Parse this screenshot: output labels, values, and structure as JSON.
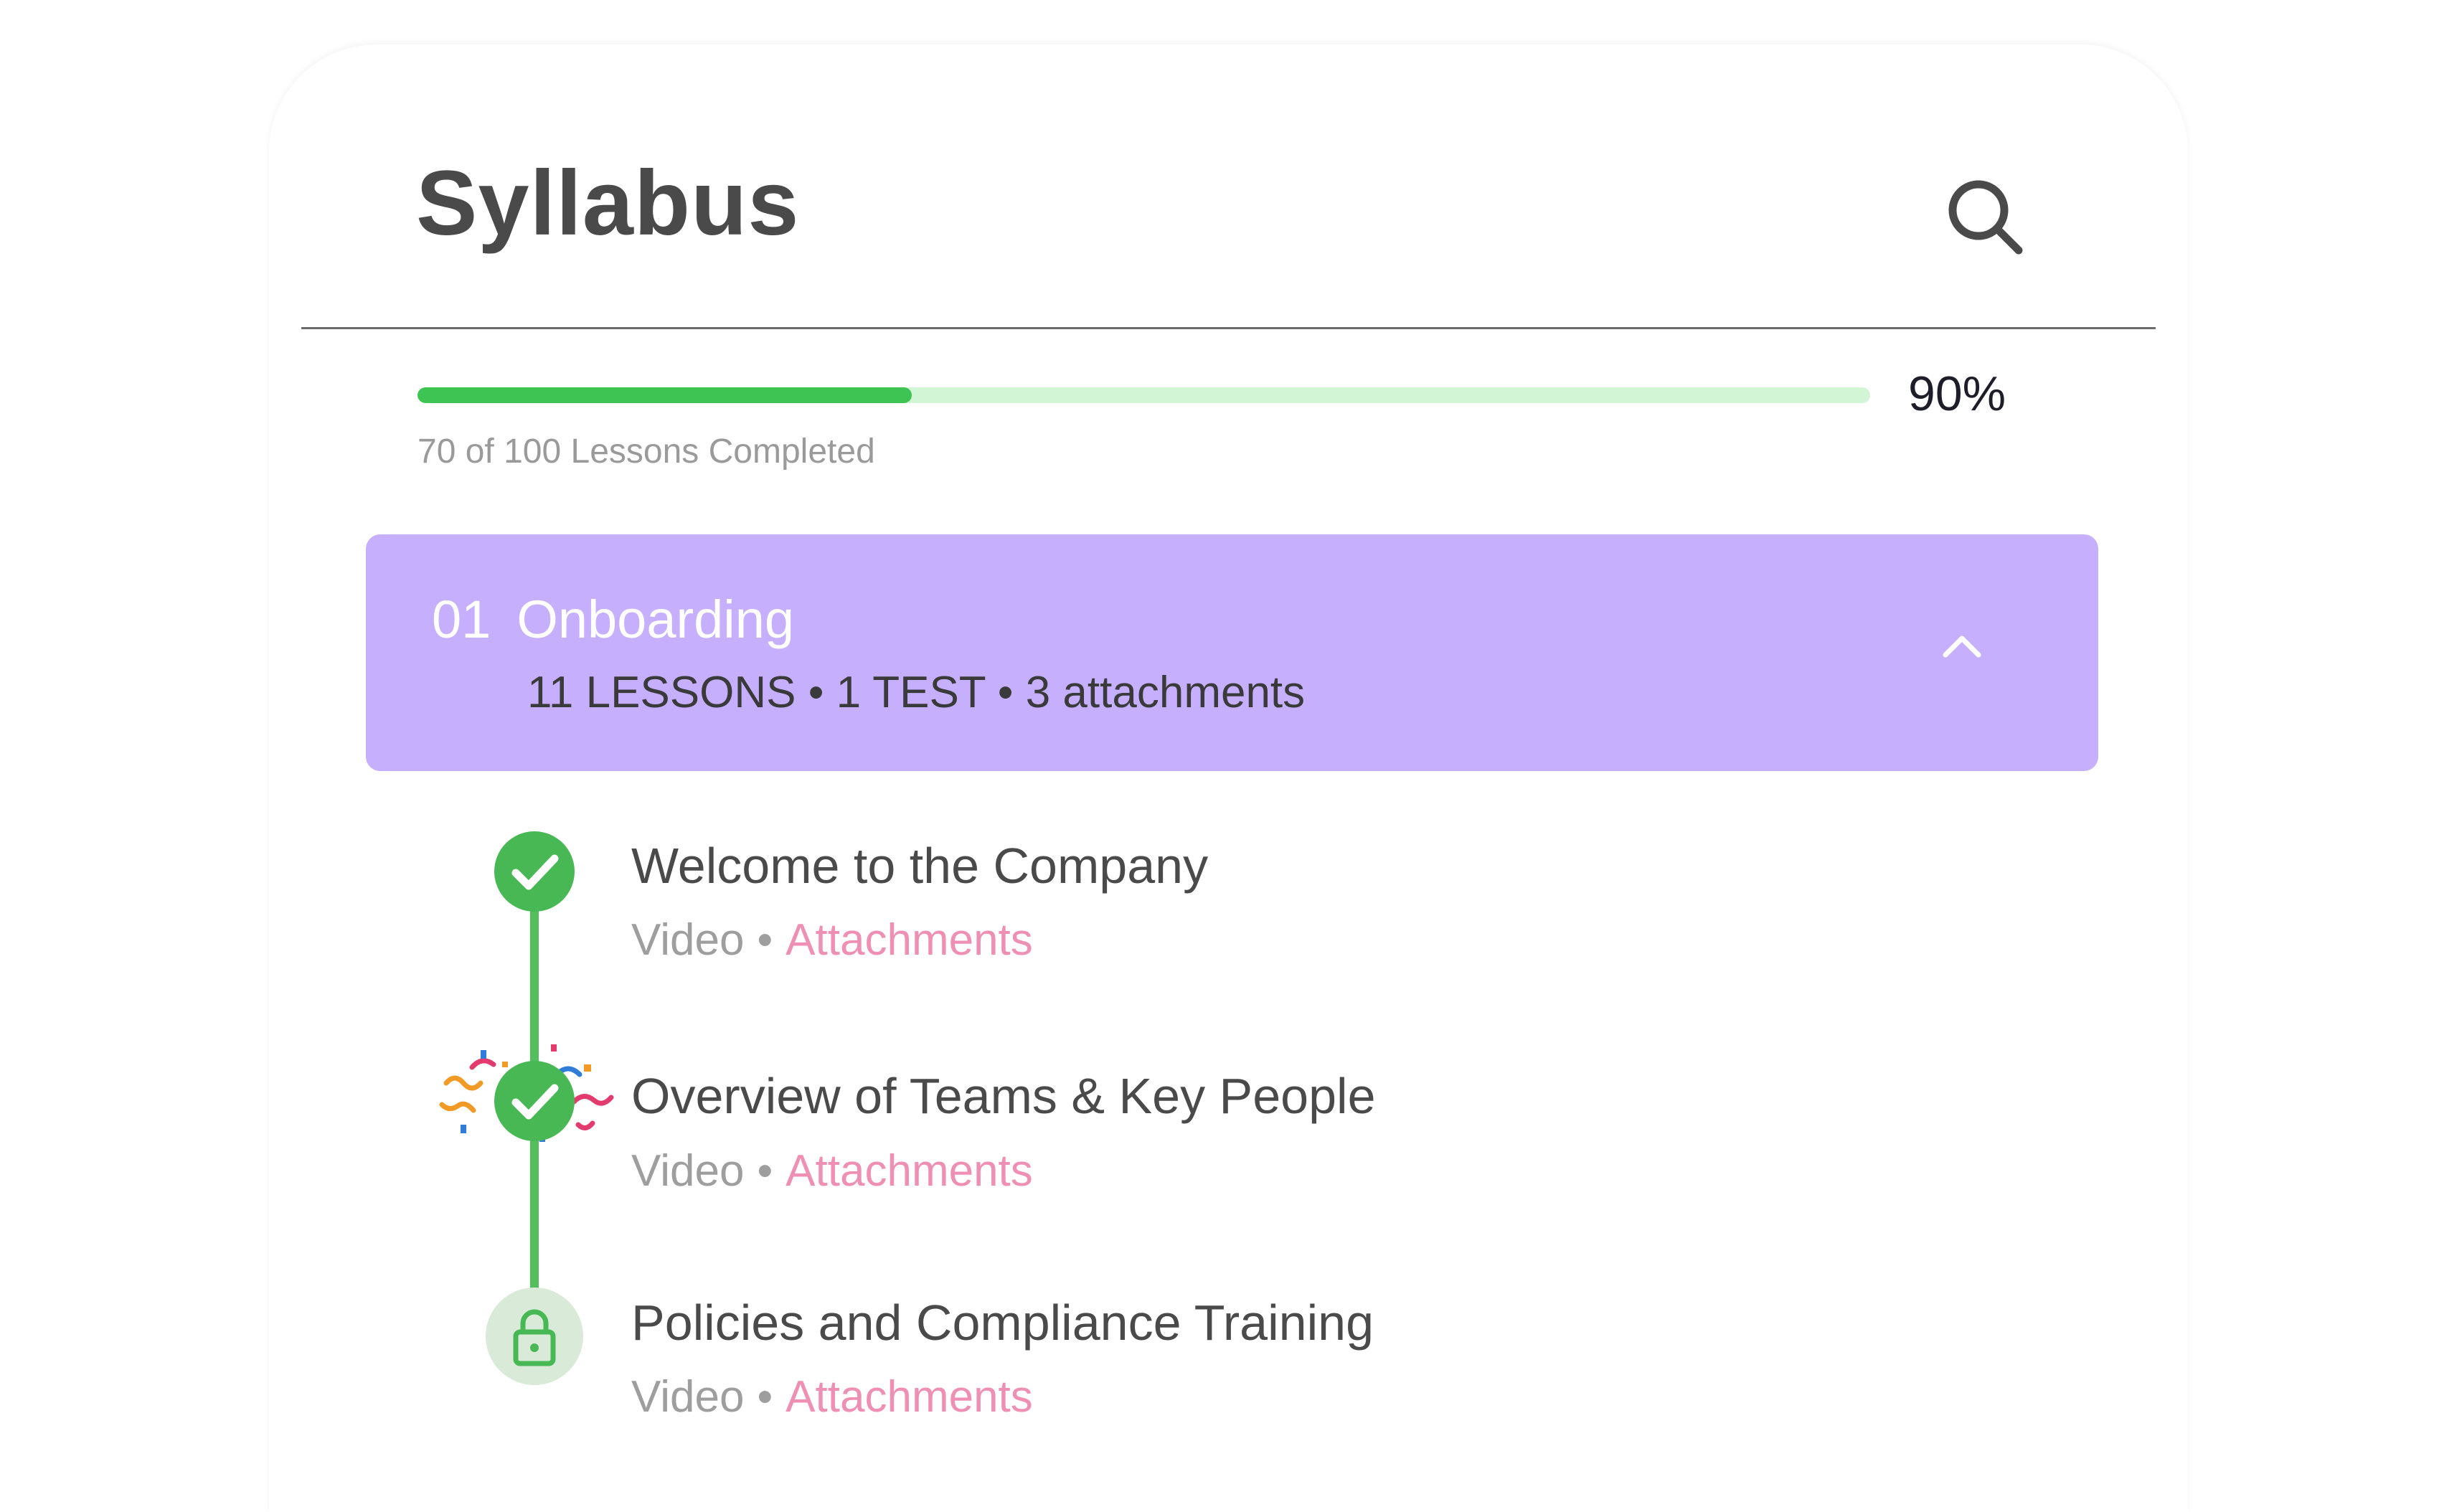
{
  "header": {
    "title": "Syllabus",
    "search_icon": "search-icon"
  },
  "progress": {
    "fraction_filled": 0.34,
    "percent_label": "90%",
    "lessons_completed_label": "70 of 100 Lessons Completed",
    "track_color": "#d2f5d6",
    "fill_color": "#3dc453"
  },
  "section": {
    "number": "01",
    "title": "Onboarding",
    "meta": "11 LESSONS • 1 TEST • 3 attachments",
    "expanded": true,
    "background_color": "#c6b0fd",
    "chevron_icon": "chevron-up-icon"
  },
  "lessons": [
    {
      "title": "Welcome to the Company",
      "type": "Video",
      "separator": "•",
      "link": "Attachments",
      "status": "completed",
      "status_icon": "check-icon"
    },
    {
      "title": "Overview of Teams & Key People",
      "type": "Video",
      "separator": "•",
      "link": "Attachments",
      "status": "completed",
      "status_icon": "check-icon",
      "decoration": "confetti"
    },
    {
      "title": "Policies and Compliance Training",
      "type": "Video",
      "separator": "•",
      "link": "Attachments",
      "status": "locked",
      "status_icon": "lock-icon"
    }
  ],
  "colors": {
    "completed": "#48b855",
    "link": "#f08fb4",
    "timeline": "#53bf5c"
  }
}
